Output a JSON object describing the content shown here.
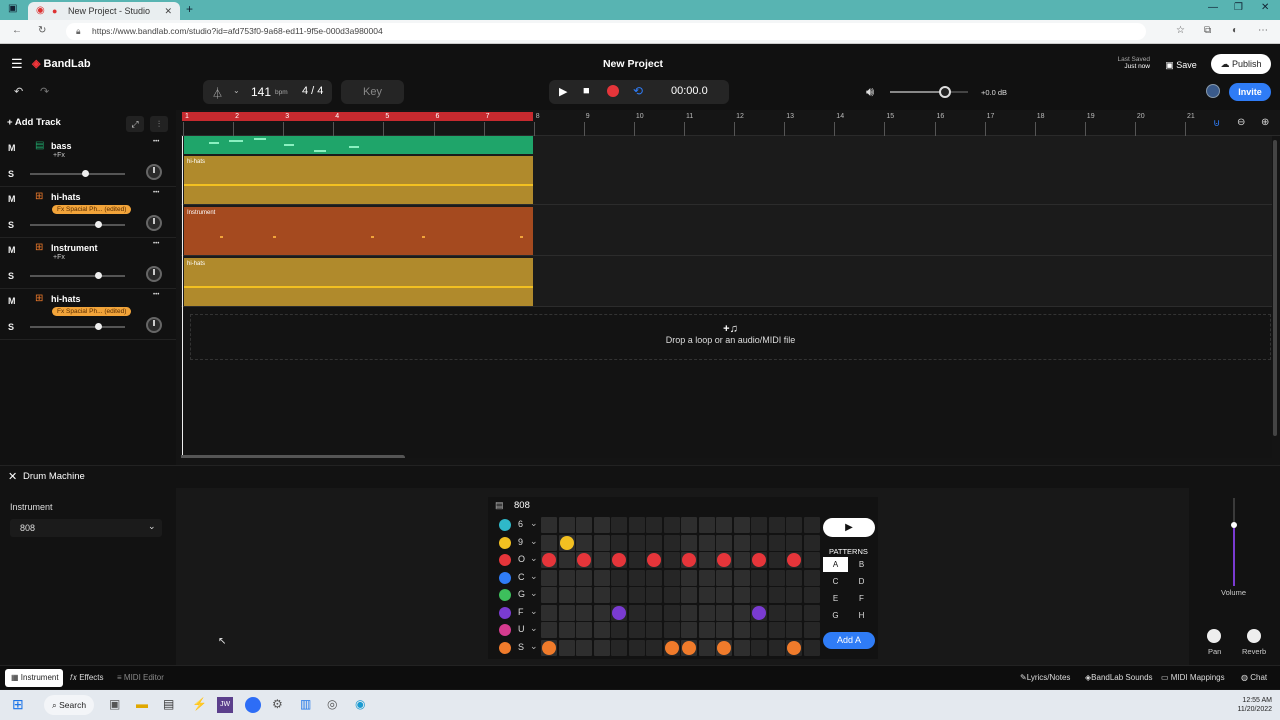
{
  "browser": {
    "tab_title": "New Project - Studio",
    "url": "https://www.bandlab.com/studio?id=afd753f0-9a68-ed11-9f5e-000d3a980004"
  },
  "header": {
    "brand": "BandLab",
    "project_title": "New Project",
    "last_saved_label": "Last Saved",
    "last_saved_value": "Just now",
    "save_label": "Save",
    "publish_label": "Publish",
    "invite_label": "Invite"
  },
  "transport": {
    "bpm": "141",
    "bpm_unit": "bpm",
    "time_sig": "4 / 4",
    "key_label": "Key",
    "time": "00:00.0",
    "master_gain": "+0.0 dB",
    "master_level": 0.7
  },
  "tracks_panel": {
    "add_track_label": "Add Track",
    "mute_label": "M",
    "solo_label": "S",
    "fx_label": "+Fx",
    "items": [
      {
        "name": "bass",
        "fx": "+Fx",
        "fx_badge": false,
        "vol": 0.58
      },
      {
        "name": "hi-hats",
        "fx": "Fx Spacial Ph... (edited)",
        "fx_badge": true,
        "vol": 0.72
      },
      {
        "name": "Instrument",
        "fx": "+Fx",
        "fx_badge": false,
        "vol": 0.72
      },
      {
        "name": "hi-hats",
        "fx": "Fx Spacial Ph... (edited)",
        "fx_badge": true,
        "vol": 0.72
      }
    ]
  },
  "timeline": {
    "bars": [
      "1",
      "2",
      "3",
      "4",
      "5",
      "6",
      "7",
      "8",
      "9",
      "10",
      "11",
      "12",
      "13",
      "14",
      "15",
      "16",
      "17",
      "18",
      "19",
      "20",
      "21"
    ],
    "region_labels": [
      "hi-hats",
      "Instrument",
      "hi-hats"
    ],
    "drop_icon": "+♫",
    "drop_text": "Drop a loop or an audio/MIDI file"
  },
  "drum_machine": {
    "title": "Drum Machine",
    "instrument_label": "Instrument",
    "instrument_value": "808",
    "kit_name": "808",
    "rows": [
      {
        "key": "6",
        "color": "#2fb8c9",
        "icon": "cymbal-icon",
        "steps": []
      },
      {
        "key": "9",
        "color": "#f2c021",
        "icon": "crash-icon",
        "steps": [
          1
        ]
      },
      {
        "key": "O",
        "color": "#e5353a",
        "icon": "open-hat-icon",
        "steps": [
          0,
          2,
          4,
          6,
          8,
          10,
          12,
          14
        ]
      },
      {
        "key": "C",
        "color": "#2f7cf6",
        "icon": "closed-hat-icon",
        "steps": []
      },
      {
        "key": "G",
        "color": "#3dbf5c",
        "icon": "tom-icon",
        "steps": []
      },
      {
        "key": "F",
        "color": "#7a3bd1",
        "icon": "snare-icon",
        "steps": [
          4,
          12
        ]
      },
      {
        "key": "U",
        "color": "#d53b8f",
        "icon": "clap-icon",
        "steps": []
      },
      {
        "key": "S",
        "color": "#f07b2b",
        "icon": "kick-icon",
        "steps": [
          0,
          7,
          8,
          10,
          14
        ]
      }
    ],
    "patterns_label": "PATTERNS",
    "patterns": [
      "A",
      "B",
      "C",
      "D",
      "E",
      "F",
      "G",
      "H"
    ],
    "active_pattern": "A",
    "add_pattern_label": "Add A",
    "volume_label": "Volume",
    "pan_label": "Pan",
    "reverb_label": "Reverb"
  },
  "bottom_tabs": {
    "left": [
      "Instrument",
      "Effects",
      "MIDI Editor"
    ],
    "right": [
      "Lyrics/Notes",
      "BandLab Sounds",
      "MIDI Mappings",
      "Chat"
    ]
  },
  "taskbar": {
    "search_label": "Search",
    "time": "12:55 AM",
    "date": "11/20/2022"
  }
}
